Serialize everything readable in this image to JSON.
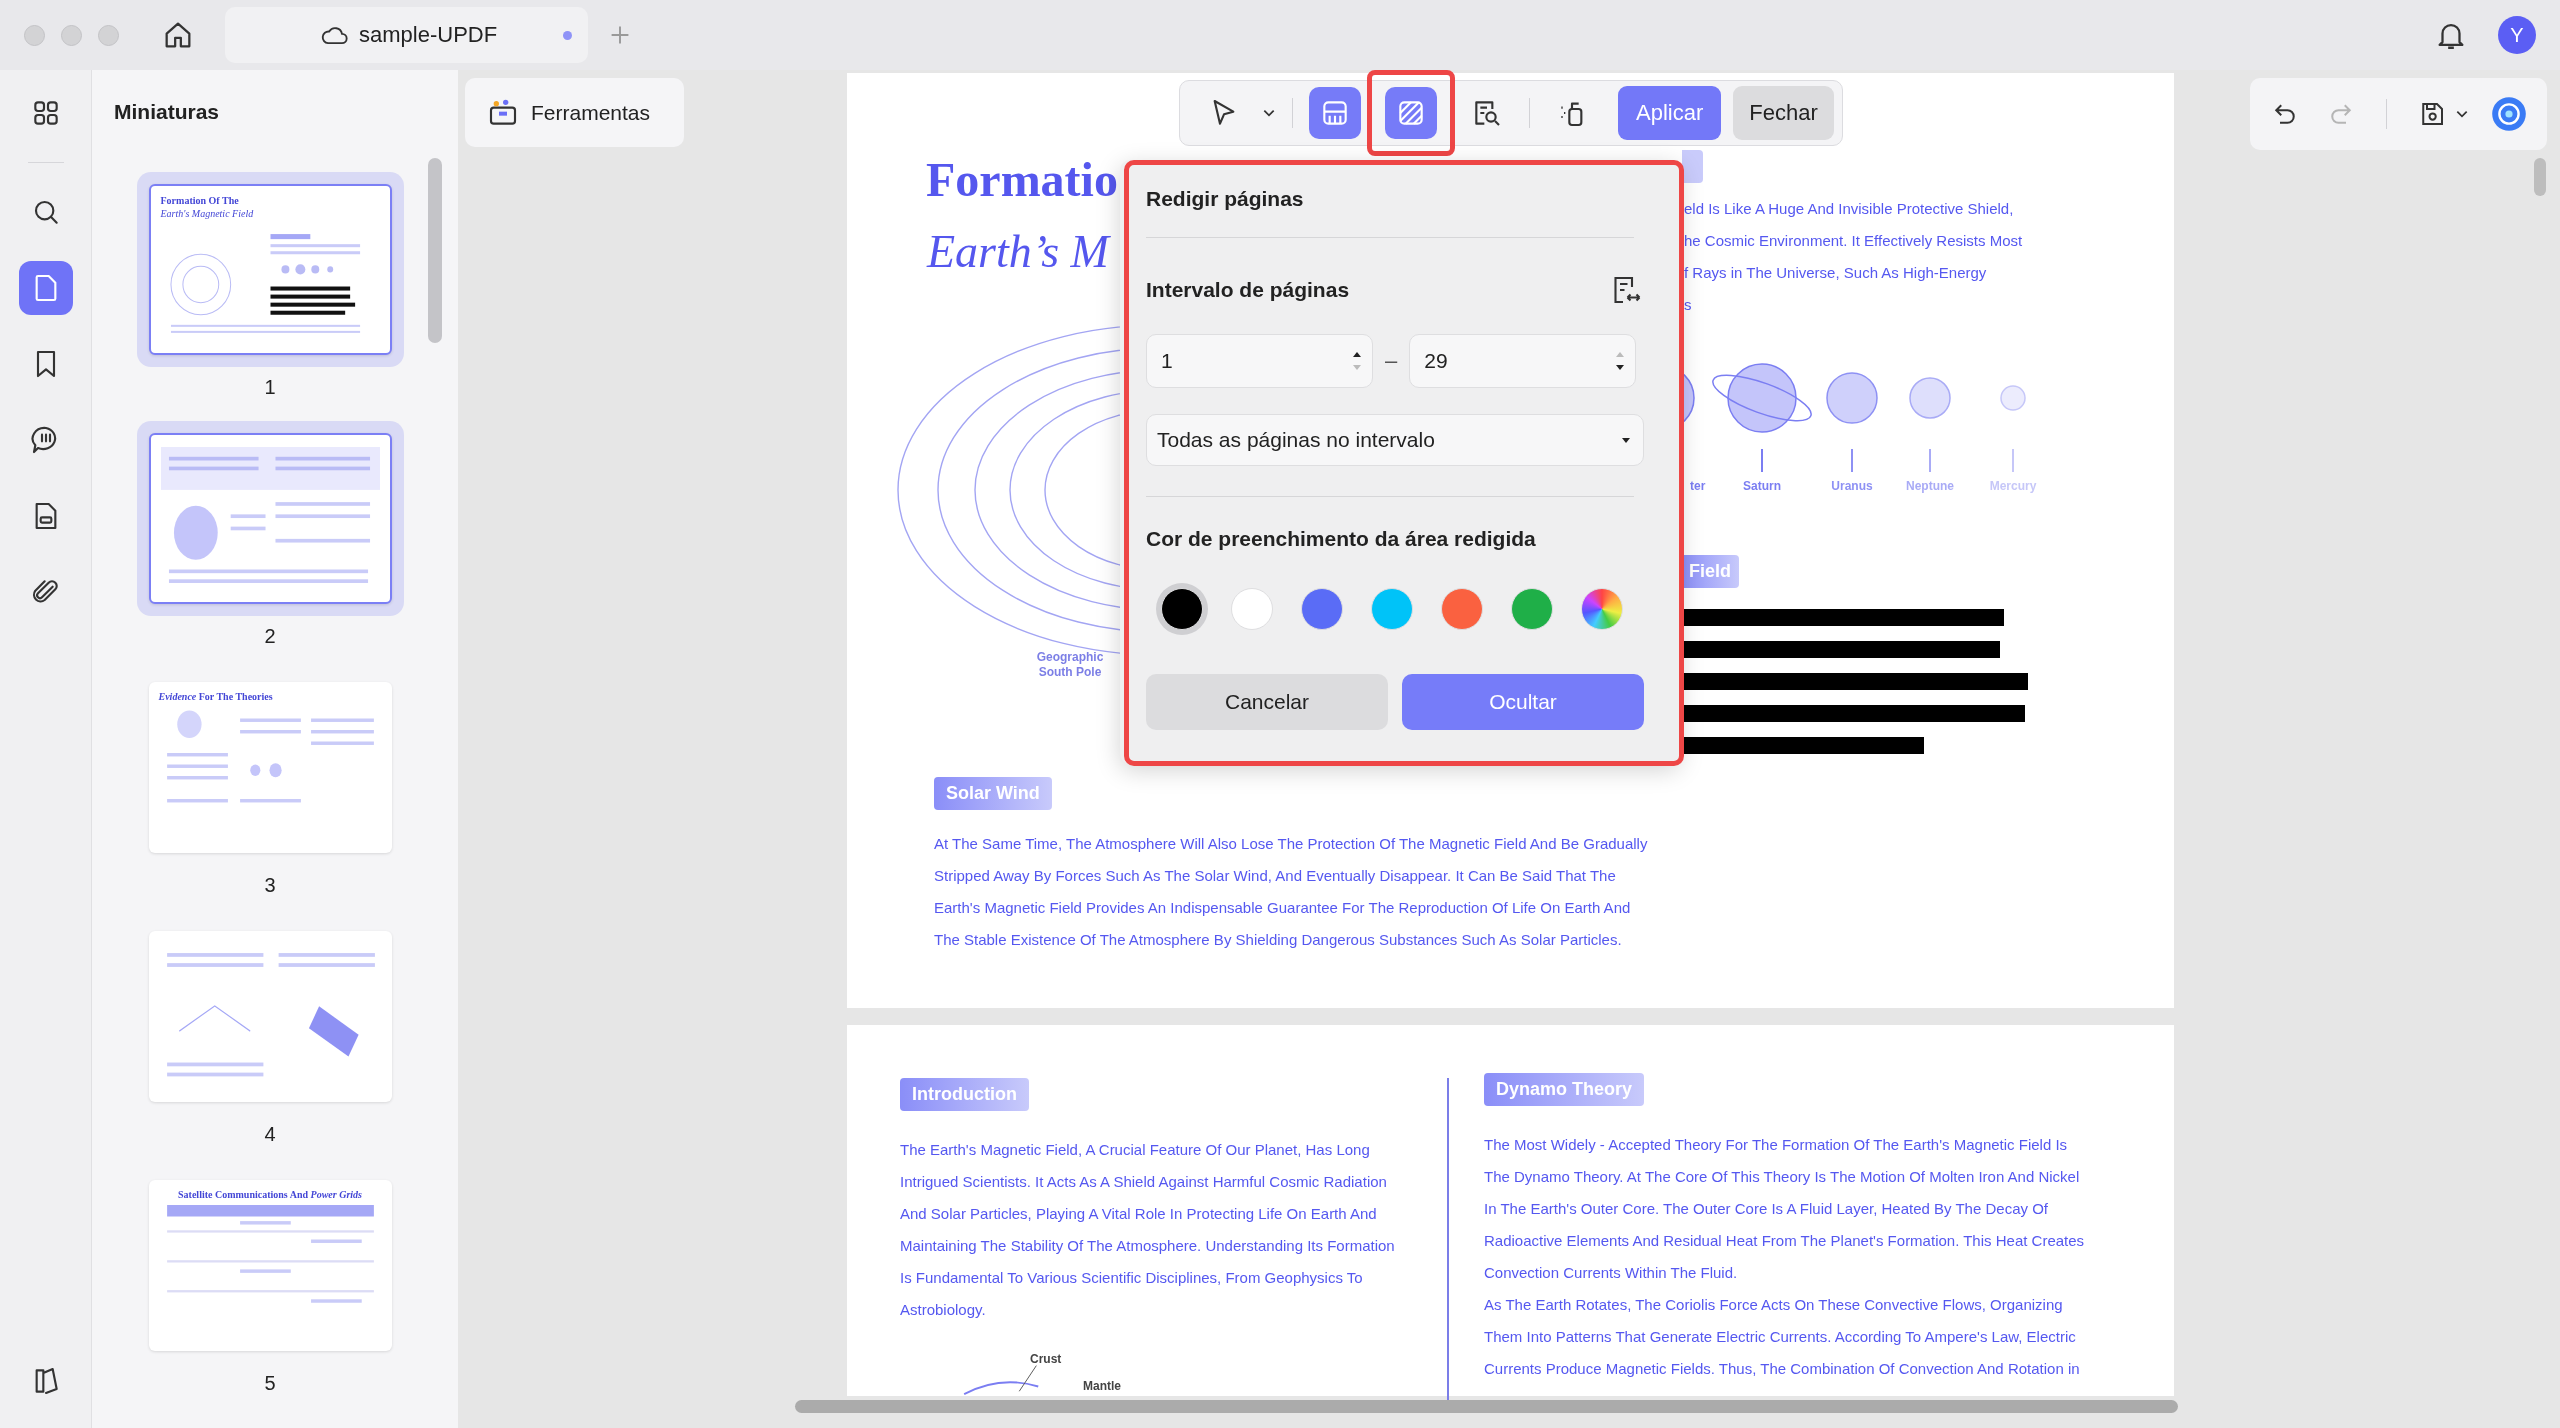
{
  "tab": {
    "title": "sample-UPDF",
    "unsaved": true
  },
  "account": {
    "initial": "Y"
  },
  "rail": {
    "items": [
      {
        "kind": "grid",
        "selected": false
      },
      {
        "kind": "search",
        "selected": false
      },
      {
        "kind": "pages",
        "selected": true
      },
      {
        "kind": "bookmark",
        "selected": false
      },
      {
        "kind": "comment",
        "selected": false
      },
      {
        "kind": "form",
        "selected": false
      },
      {
        "kind": "attachment",
        "selected": false
      },
      {
        "kind": "reader",
        "selected": false
      }
    ]
  },
  "thumbnails": {
    "title": "Miniaturas",
    "items": [
      {
        "label": "1",
        "selected": true,
        "title": "Formation Of The",
        "subtitle": "Earth's Magnetic Field"
      },
      {
        "label": "2",
        "selected": true
      },
      {
        "label": "3",
        "selected": false,
        "title": "*Evidence* For The Theories"
      },
      {
        "label": "4",
        "selected": false
      },
      {
        "label": "5",
        "selected": false,
        "title": "Satellite Communications And *Power Grids*"
      }
    ]
  },
  "tools_button": {
    "label": "Ferramentas"
  },
  "toolbar": {
    "tools": [
      {
        "kind": "pointer",
        "selected": false
      },
      {
        "kind": "redact-area",
        "selected": true
      },
      {
        "kind": "redact-pages",
        "selected": true,
        "highlighted": true
      },
      {
        "kind": "search-redact",
        "selected": false
      },
      {
        "kind": "sanitize",
        "selected": false
      }
    ],
    "apply": "Aplicar",
    "close": "Fechar"
  },
  "history": [
    {
      "kind": "undo",
      "disabled": false
    },
    {
      "kind": "redo",
      "disabled": true
    }
  ],
  "redact_dialog": {
    "title": "Redigir páginas",
    "highlighted": true,
    "range_label": "Intervalo de páginas",
    "from": {
      "value": "1",
      "can_increase": true,
      "can_decrease": false
    },
    "separator": "–",
    "to": {
      "value": "29",
      "can_increase": false,
      "can_decrease": true
    },
    "subset": "Todas as páginas no intervalo",
    "fill_label": "Cor de preenchimento da área redigida",
    "colors": [
      {
        "kind": "solid",
        "color": "#000000",
        "selected": true
      },
      {
        "kind": "solid",
        "color": "#ffffff",
        "selected": false
      },
      {
        "kind": "solid",
        "color": "#5a6cf6",
        "selected": false
      },
      {
        "kind": "solid",
        "color": "#00c3f8",
        "selected": false
      },
      {
        "kind": "solid",
        "color": "#fa6140",
        "selected": false
      },
      {
        "kind": "solid",
        "color": "#1faf48",
        "selected": false
      },
      {
        "kind": "spectrum",
        "selected": false
      }
    ],
    "cancel": "Cancelar",
    "confirm": "Ocultar"
  },
  "page_1": {
    "title": "Formatio",
    "subtitle": "Earth’s M",
    "right_lines": [
      "eld Is Like A Huge And Invisible Protective Shield,",
      "he Cosmic Environment. It Effectively Resists Most",
      "f Rays in The Universe, Such As High-Energy",
      "s"
    ],
    "planets": [
      "ter",
      "Saturn",
      "Uranus",
      "Neptune",
      "Mercury"
    ],
    "field_heading": "Field",
    "diagram_label": [
      "Geographic",
      "South Pole"
    ],
    "section": {
      "heading": "Solar Wind",
      "lines": [
        "At The Same Time, The Atmosphere Will Also Lose The Protection Of The Magnetic Field And Be Gradually",
        "Stripped Away By Forces Such As The Solar Wind, And Eventually Disappear. It Can Be Said That The",
        "Earth's Magnetic Field Provides An Indispensable Guarantee For The Reproduction Of Life On Earth And",
        "The Stable Existence Of The Atmosphere By Shielding Dangerous Substances Such As Solar Particles."
      ]
    }
  },
  "page_2": {
    "columns": [
      {
        "heading": "Introduction",
        "paragraphs": [
          [
            "The Earth's Magnetic Field, A Crucial Feature Of Our Planet, Has Long",
            "Intrigued Scientists. It Acts As A Shield Against Harmful Cosmic Radiation",
            "And Solar Particles, Playing A Vital Role In Protecting Life On Earth And",
            "Maintaining The Stability Of The Atmosphere. Understanding Its Formation",
            "Is Fundamental To Various Scientific Disciplines, From Geophysics To",
            "Astrobiology."
          ]
        ],
        "figure_labels": [
          "Crust",
          "Mantle"
        ]
      },
      {
        "heading": "Dynamo Theory",
        "paragraphs": [
          [
            "The Most Widely - Accepted Theory For The Formation Of The Earth's Magnetic Field Is",
            "The Dynamo Theory. At The Core Of This Theory Is The Motion Of Molten Iron And Nickel",
            "In The Earth's Outer Core. The Outer Core Is A Fluid Layer, Heated By The Decay Of",
            "Radioactive Elements And Residual Heat From The Planet's Formation. This Heat Creates",
            "Convection Currents Within The Fluid."
          ],
          [
            "As The Earth Rotates, The Coriolis Force Acts On These Convective Flows, Organizing",
            "Them Into Patterns That Generate Electric Currents. According To Ampere's Law, Electric",
            "Currents Produce Magnetic Fields. Thus, The Combination Of Convection And Rotation in"
          ]
        ]
      }
    ]
  }
}
